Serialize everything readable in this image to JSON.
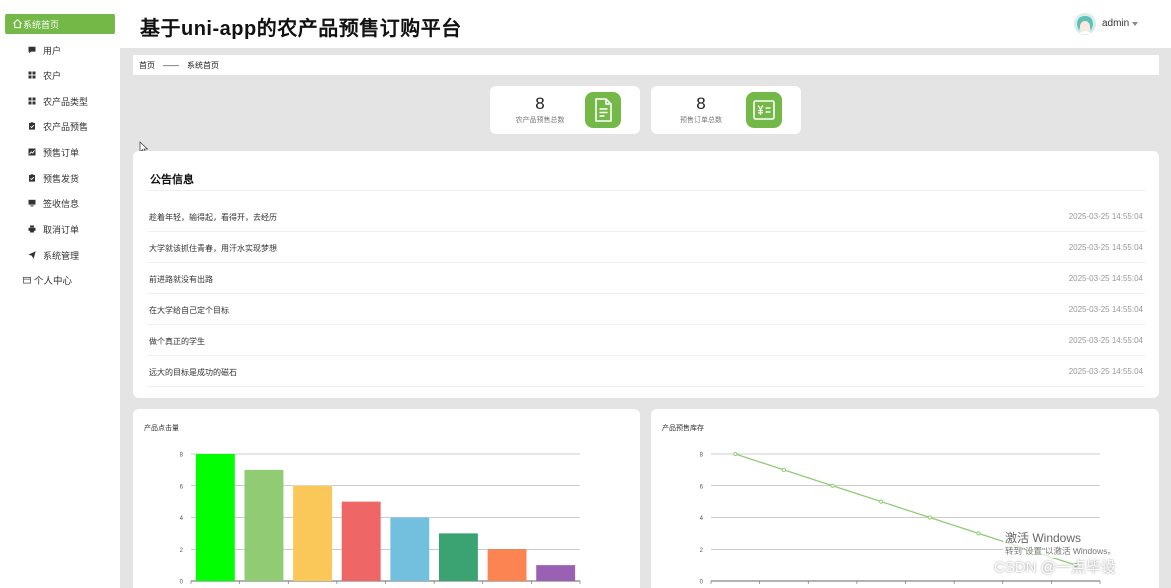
{
  "sidebar": {
    "home_label": "系统首页",
    "items": [
      {
        "label": "用户",
        "icon": "chat-icon"
      },
      {
        "label": "农户",
        "icon": "grid-icon"
      },
      {
        "label": "农产品类型",
        "icon": "grid-icon"
      },
      {
        "label": "农产品预售",
        "icon": "clipboard-icon"
      },
      {
        "label": "预售订单",
        "icon": "chart-icon"
      },
      {
        "label": "预售发货",
        "icon": "clipboard-icon"
      },
      {
        "label": "签收信息",
        "icon": "monitor-icon"
      },
      {
        "label": "取消订单",
        "icon": "print-icon"
      },
      {
        "label": "系统管理",
        "icon": "send-icon"
      }
    ],
    "personal_label": "个人中心"
  },
  "header": {
    "title": "基于uni-app的农产品预售订购平台",
    "username": "admin"
  },
  "breadcrumb": {
    "home": "首页",
    "separator": "——",
    "current": "系统首页"
  },
  "stats": [
    {
      "value": "8",
      "label": "农产品预售总数",
      "icon": "document-icon"
    },
    {
      "value": "8",
      "label": "预售订单总数",
      "icon": "yen-icon"
    }
  ],
  "notice": {
    "title": "公告信息",
    "items": [
      {
        "text": "趁着年轻，输得起，看得开，去经历",
        "time": "2025-03-25 14:55:04"
      },
      {
        "text": "大学就该抓住青春，用汗水实现梦想",
        "time": "2025-03-25 14:55:04"
      },
      {
        "text": "前进路就没有出路",
        "time": "2025-03-25 14:55:04"
      },
      {
        "text": "在大学给自己定个目标",
        "time": "2025-03-25 14:55:04"
      },
      {
        "text": "做个真正的学生",
        "time": "2025-03-25 14:55:04"
      },
      {
        "text": "远大的目标是成功的磁石",
        "time": "2025-03-25 14:55:04"
      }
    ]
  },
  "chart_data": [
    {
      "type": "bar",
      "title": "产品点击量",
      "ylim": [
        0,
        8
      ],
      "yticks": [
        0,
        2,
        4,
        6,
        8
      ],
      "values": [
        8,
        7,
        6,
        5,
        4,
        3,
        2,
        1
      ],
      "colors": [
        "#00ff00",
        "#91cc75",
        "#fac858",
        "#ee6666",
        "#73c0de",
        "#3ba272",
        "#fc8452",
        "#9a60b4"
      ],
      "grid": true
    },
    {
      "type": "line",
      "title": "产品预售库存",
      "ylim": [
        0,
        8
      ],
      "yticks": [
        0,
        2,
        4,
        6,
        8
      ],
      "values": [
        8,
        7,
        6,
        5,
        4,
        3,
        2,
        1
      ],
      "color": "#91cc75",
      "grid": true
    }
  ],
  "watermark": {
    "activation_title": "激活 Windows",
    "activation_hint": "转到\"设置\"以激活 Windows。",
    "csdn": "CSDN @一点毕设"
  },
  "colors": {
    "accent": "#74b847"
  }
}
